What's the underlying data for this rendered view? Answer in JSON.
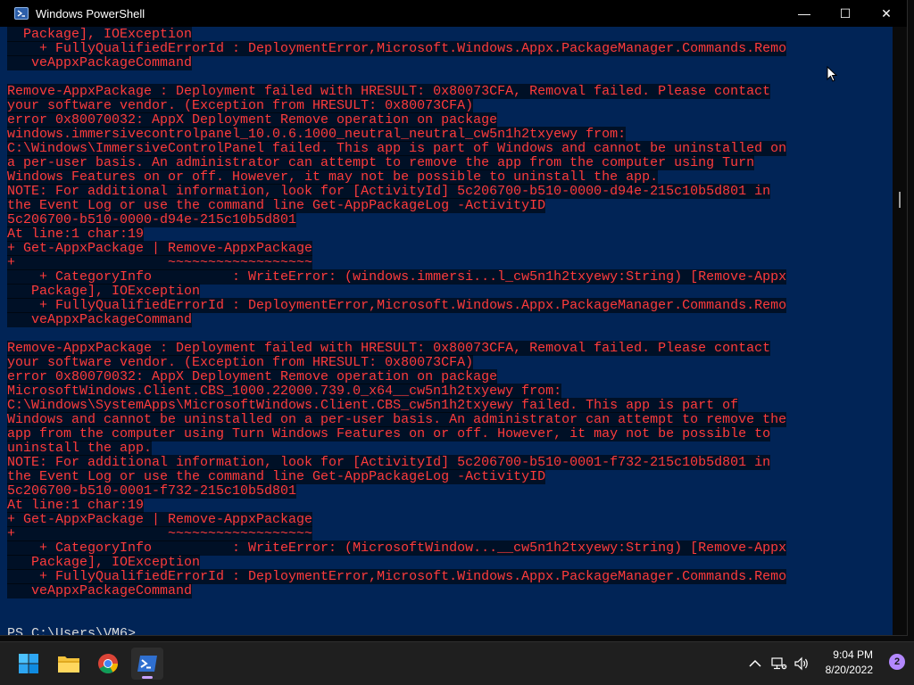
{
  "window": {
    "title": "Windows PowerShell",
    "controls": {
      "minimize": "—",
      "maximize": "☐",
      "close": "✕"
    }
  },
  "terminal": {
    "lines": [
      "  Package], IOException",
      "    + FullyQualifiedErrorId : DeploymentError,Microsoft.Windows.Appx.PackageManager.Commands.Remo",
      "   veAppxPackageCommand",
      "",
      "Remove-AppxPackage : Deployment failed with HRESULT: 0x80073CFA, Removal failed. Please contact",
      "your software vendor. (Exception from HRESULT: 0x80073CFA)",
      "error 0x80070032: AppX Deployment Remove operation on package",
      "windows.immersivecontrolpanel_10.0.6.1000_neutral_neutral_cw5n1h2txyewy from:",
      "C:\\Windows\\ImmersiveControlPanel failed. This app is part of Windows and cannot be uninstalled on",
      "a per-user basis. An administrator can attempt to remove the app from the computer using Turn",
      "Windows Features on or off. However, it may not be possible to uninstall the app.",
      "NOTE: For additional information, look for [ActivityId] 5c206700-b510-0000-d94e-215c10b5d801 in",
      "the Event Log or use the command line Get-AppPackageLog -ActivityID",
      "5c206700-b510-0000-d94e-215c10b5d801",
      "At line:1 char:19",
      "+ Get-AppxPackage | Remove-AppxPackage",
      "+                   ~~~~~~~~~~~~~~~~~~",
      "    + CategoryInfo          : WriteError: (windows.immersi...l_cw5n1h2txyewy:String) [Remove-Appx",
      "   Package], IOException",
      "    + FullyQualifiedErrorId : DeploymentError,Microsoft.Windows.Appx.PackageManager.Commands.Remo",
      "   veAppxPackageCommand",
      "",
      "Remove-AppxPackage : Deployment failed with HRESULT: 0x80073CFA, Removal failed. Please contact",
      "your software vendor. (Exception from HRESULT: 0x80073CFA)",
      "error 0x80070032: AppX Deployment Remove operation on package",
      "MicrosoftWindows.Client.CBS_1000.22000.739.0_x64__cw5n1h2txyewy from:",
      "C:\\Windows\\SystemApps\\MicrosoftWindows.Client.CBS_cw5n1h2txyewy failed. This app is part of",
      "Windows and cannot be uninstalled on a per-user basis. An administrator can attempt to remove the",
      "app from the computer using Turn Windows Features on or off. However, it may not be possible to",
      "uninstall the app.",
      "NOTE: For additional information, look for [ActivityId] 5c206700-b510-0001-f732-215c10b5d801 in",
      "the Event Log or use the command line Get-AppPackageLog -ActivityID",
      "5c206700-b510-0001-f732-215c10b5d801",
      "At line:1 char:19",
      "+ Get-AppxPackage | Remove-AppxPackage",
      "+                   ~~~~~~~~~~~~~~~~~~",
      "    + CategoryInfo          : WriteError: (MicrosoftWindow...__cw5n1h2txyewy:String) [Remove-Appx",
      "   Package], IOException",
      "    + FullyQualifiedErrorId : DeploymentError,Microsoft.Windows.Appx.PackageManager.Commands.Remo",
      "   veAppxPackageCommand",
      "",
      ""
    ],
    "prompt": "PS C:\\Users\\VM6> "
  },
  "taskbar": {
    "apps": [
      {
        "name": "windows-start-icon"
      },
      {
        "name": "file-explorer-icon"
      },
      {
        "name": "chrome-icon"
      },
      {
        "name": "powershell-icon",
        "active": true
      }
    ],
    "tray": {
      "time": "9:04 PM",
      "date": "8/20/2022",
      "notifications": "2"
    }
  },
  "colors": {
    "background": "#012456",
    "error_text": "#ff3b3b",
    "prompt_text": "#d9d9d9",
    "accent": "#b388ff"
  }
}
